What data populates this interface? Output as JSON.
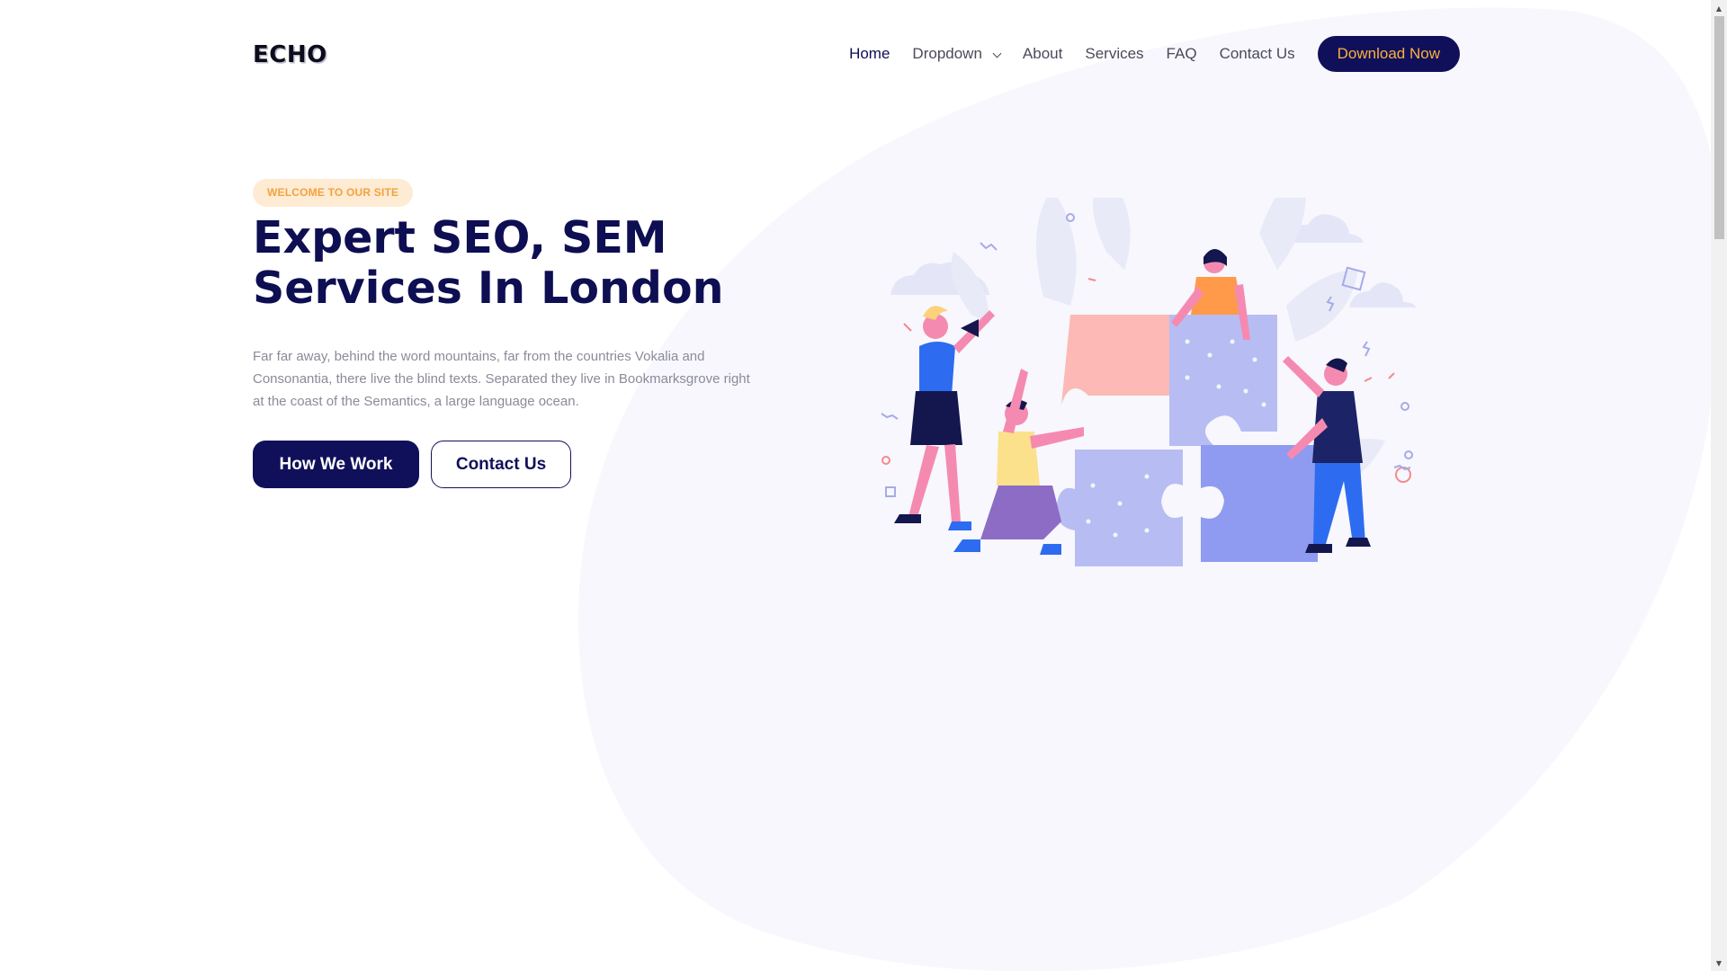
{
  "header": {
    "logo": "ECHO",
    "nav": [
      {
        "label": "Home",
        "active": true
      },
      {
        "label": "Dropdown",
        "has_dropdown": true
      },
      {
        "label": "About"
      },
      {
        "label": "Services"
      },
      {
        "label": "FAQ"
      },
      {
        "label": "Contact Us"
      }
    ],
    "cta_label": "Download Now"
  },
  "hero": {
    "badge": "WELCOME TO OUR SITE",
    "headline_line1": "Expert SEO, SEM",
    "headline_line2": "Services In London",
    "description": "Far far away, behind the word mountains, far from the countries Vokalia and Consonantia, there live the blind texts. Separated they live in Bookmarksgrove right at the coast of the Semantics, a large language ocean.",
    "primary_button": "How We Work",
    "secondary_button": "Contact Us"
  },
  "illustration": {
    "description_icon": "team-puzzle-illustration-icon"
  },
  "colors": {
    "navy": "#10105a",
    "accent_orange": "#fbb040",
    "badge_bg": "#fdebd4",
    "blob_bg": "#f7f7fd"
  }
}
